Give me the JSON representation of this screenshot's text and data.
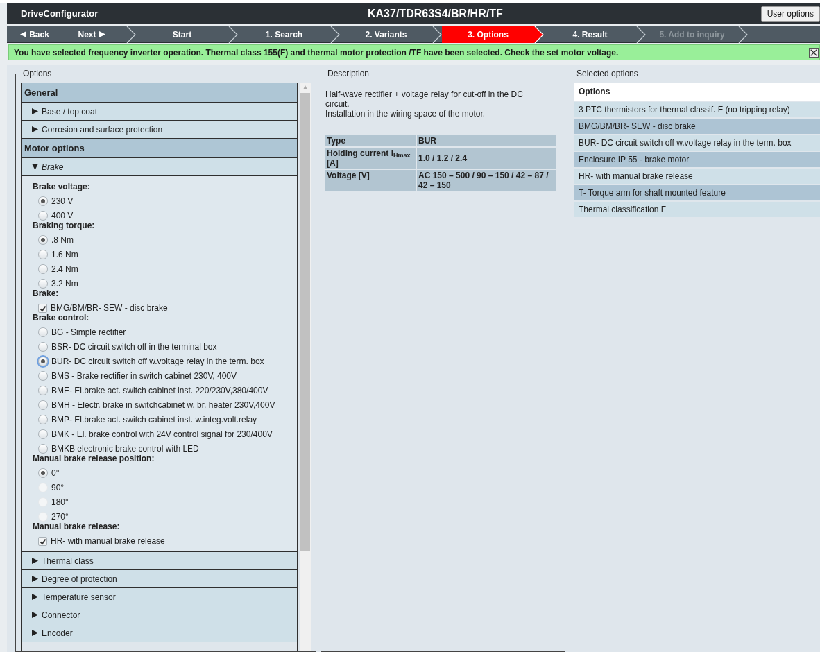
{
  "header": {
    "app_name": "DriveConfigurator",
    "title": "KA37/TDR63S4/BR/HR/TF",
    "user_button": "User options"
  },
  "steps": [
    {
      "kind": "back",
      "label": "Back",
      "selected": false,
      "disabled": false
    },
    {
      "kind": "next",
      "label": "Next",
      "selected": false,
      "disabled": false
    },
    {
      "kind": "step",
      "label": "Start",
      "selected": false,
      "disabled": false
    },
    {
      "kind": "step",
      "label": "1. Search",
      "selected": false,
      "disabled": false
    },
    {
      "kind": "step",
      "label": "2. Variants",
      "selected": false,
      "disabled": false
    },
    {
      "kind": "step",
      "label": "3. Options",
      "selected": true,
      "disabled": false
    },
    {
      "kind": "step",
      "label": "4. Result",
      "selected": false,
      "disabled": false
    },
    {
      "kind": "step",
      "label": "5. Add to inquiry",
      "selected": false,
      "disabled": true
    }
  ],
  "message": {
    "text": "You have selected frequency inverter operation. Thermal class 155(F) and thermal motor protection /TF have been selected. Check the set motor voltage."
  },
  "options_panel": {
    "legend": "Options",
    "groups": [
      {
        "title": "General",
        "items": [
          {
            "label": "Base / top coat",
            "expanded": false
          },
          {
            "label": "Corrosion and surface protection",
            "expanded": false
          }
        ]
      },
      {
        "title": "Motor options",
        "items": [
          {
            "label": "Brake",
            "expanded": true,
            "sections": [
              {
                "heading": "Brake voltage:",
                "choices": [
                  {
                    "kind": "radio",
                    "label": "230 V",
                    "checked": true,
                    "disabled": false
                  },
                  {
                    "kind": "radio",
                    "label": "400 V",
                    "checked": false,
                    "disabled": false
                  }
                ]
              },
              {
                "heading": "Braking torque:",
                "choices": [
                  {
                    "kind": "radio",
                    "label": ".8 Nm",
                    "checked": true,
                    "disabled": false
                  },
                  {
                    "kind": "radio",
                    "label": "1.6 Nm",
                    "checked": false,
                    "disabled": false
                  },
                  {
                    "kind": "radio",
                    "label": "2.4 Nm",
                    "checked": false,
                    "disabled": false
                  },
                  {
                    "kind": "radio",
                    "label": "3.2 Nm",
                    "checked": false,
                    "disabled": false
                  }
                ]
              },
              {
                "heading": "Brake:",
                "choices": [
                  {
                    "kind": "checkbox",
                    "label": "BMG/BM/BR- SEW - disc brake",
                    "checked": true,
                    "disabled": false
                  }
                ]
              },
              {
                "heading": "Brake control:",
                "choices": [
                  {
                    "kind": "radio",
                    "label": "BG - Simple rectifier",
                    "checked": false,
                    "disabled": false
                  },
                  {
                    "kind": "radio",
                    "label": "BSR- DC circuit switch off in the terminal box",
                    "checked": false,
                    "disabled": false
                  },
                  {
                    "kind": "radio",
                    "label": "BUR- DC circuit switch off w.voltage relay in the term. box",
                    "checked": true,
                    "disabled": false,
                    "focused": true
                  },
                  {
                    "kind": "radio",
                    "label": "BMS - Brake rectifier in switch cabinet 230V, 400V",
                    "checked": false,
                    "disabled": false
                  },
                  {
                    "kind": "radio",
                    "label": "BME- El.brake act. switch cabinet inst. 220/230V,380/400V",
                    "checked": false,
                    "disabled": false
                  },
                  {
                    "kind": "radio",
                    "label": "BMH - Electr. brake in switchcabinet w. br. heater 230V,400V",
                    "checked": false,
                    "disabled": false
                  },
                  {
                    "kind": "radio",
                    "label": "BMP- El.brake act. switch cabinet inst. w.integ.volt.relay",
                    "checked": false,
                    "disabled": false
                  },
                  {
                    "kind": "radio",
                    "label": "BMK - El. brake control with 24V control signal for 230/400V",
                    "checked": false,
                    "disabled": false
                  },
                  {
                    "kind": "radio",
                    "label": "BMKB electronic brake control with LED",
                    "checked": false,
                    "disabled": false
                  }
                ]
              },
              {
                "heading": "Manual brake release position:",
                "choices": [
                  {
                    "kind": "radio",
                    "label": "0°",
                    "checked": true,
                    "disabled": false
                  },
                  {
                    "kind": "radio",
                    "label": "90°",
                    "checked": false,
                    "disabled": true
                  },
                  {
                    "kind": "radio",
                    "label": "180°",
                    "checked": false,
                    "disabled": true
                  },
                  {
                    "kind": "radio",
                    "label": "270°",
                    "checked": false,
                    "disabled": true
                  }
                ]
              },
              {
                "heading": "Manual brake release:",
                "choices": [
                  {
                    "kind": "checkbox",
                    "label": "HR- with manual brake release",
                    "checked": true,
                    "disabled": false
                  }
                ]
              }
            ]
          },
          {
            "label": "Thermal class",
            "expanded": false
          },
          {
            "label": "Degree of protection",
            "expanded": false
          },
          {
            "label": "Temperature sensor",
            "expanded": false
          },
          {
            "label": "Connector",
            "expanded": false
          },
          {
            "label": "Encoder",
            "expanded": false
          }
        ]
      }
    ]
  },
  "description": {
    "legend": "Description",
    "paragraphs": [
      "Half-wave rectifier + voltage relay for cut-off in the DC circuit.",
      "Installation in the wiring space of the motor."
    ],
    "table": [
      {
        "label": "Type",
        "value": "BUR"
      },
      {
        "label": "Holding current I$_{Hmax}$ [A]",
        "value": "1.0 / 1.2 / 2.4"
      },
      {
        "label": "Voltage [V]",
        "value": "AC 150 – 500 / 90 – 150 / 42 – 87 / 42 – 150"
      }
    ]
  },
  "selected_options": {
    "legend": "Selected options",
    "header": "Options",
    "items": [
      "3 PTC thermistors for thermal classif. F (no tripping relay)",
      "BMG/BM/BR- SEW - disc brake",
      "BUR- DC circuit switch off w.voltage relay in the term. box",
      "Enclosure IP 55 - brake motor",
      "HR- with manual brake release",
      "T- Torque arm for shaft mounted feature",
      "Thermal classification F"
    ]
  }
}
